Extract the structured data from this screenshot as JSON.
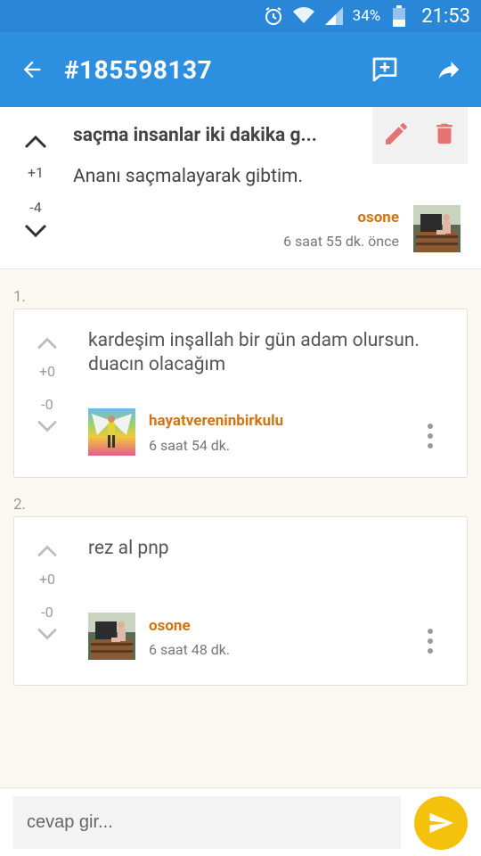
{
  "status_bar": {
    "battery_pct": "34%",
    "time": "21:53"
  },
  "app_bar": {
    "title": "#185598137"
  },
  "post": {
    "title": "saçma insanlar iki dakika g...",
    "body": "Ananı saçmalayarak gibtim.",
    "upvotes": "+1",
    "downvotes": "-4",
    "author": "osone",
    "time": "6 saat 55 dk. önce"
  },
  "comments": [
    {
      "index": "1.",
      "text": "kardeşim inşallah bir gün adam olursun. duacın olacağım",
      "upvotes": "+0",
      "downvotes": "-0",
      "author": "hayatvereninbirkulu",
      "time": "6 saat 54 dk."
    },
    {
      "index": "2.",
      "text": "rez al pnp",
      "upvotes": "+0",
      "downvotes": "-0",
      "author": "osone",
      "time": "6 saat 48 dk."
    }
  ],
  "reply": {
    "placeholder": "cevap gir..."
  },
  "colors": {
    "appbar": "#2d8fe0",
    "author": "#d07414",
    "send": "#f4c20d",
    "delete": "#e57373"
  },
  "icons": [
    "alarm-icon",
    "wifi-icon",
    "signal-icon",
    "battery-icon",
    "back-arrow-icon",
    "add-comment-icon",
    "share-icon",
    "edit-icon",
    "delete-icon",
    "chevron-up-icon",
    "chevron-down-icon",
    "more-vert-icon",
    "send-icon"
  ]
}
